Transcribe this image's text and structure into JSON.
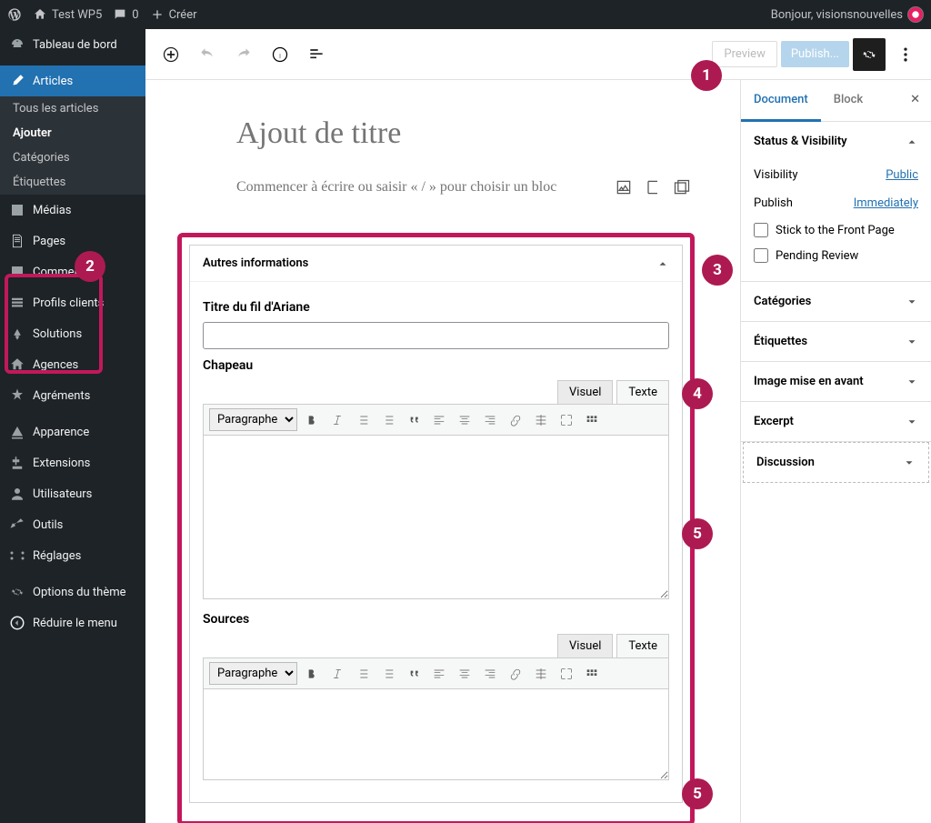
{
  "adminbar": {
    "site_name": "Test WP5",
    "comments_count": "0",
    "create": "Créer",
    "greeting": "Bonjour, visionsnouvelles"
  },
  "sidebar": {
    "dashboard": "Tableau de bord",
    "articles": "Articles",
    "submenu": {
      "all": "Tous les articles",
      "add": "Ajouter",
      "categories": "Catégories",
      "tags": "Étiquettes"
    },
    "media": "Médias",
    "pages": "Pages",
    "comments": "Commenta",
    "profils": "Profils clients",
    "solutions": "Solutions",
    "agences": "Agences",
    "agrements": "Agréments",
    "appearance": "Apparence",
    "plugins": "Extensions",
    "users": "Utilisateurs",
    "tools": "Outils",
    "settings": "Réglages",
    "theme_options": "Options du thème",
    "collapse": "Réduire le menu"
  },
  "editor": {
    "preview": "Preview",
    "publish": "Publish...",
    "title_placeholder": "Ajout de titre",
    "block_prompt": "Commencer à écrire ou saisir « / » pour choisir un bloc"
  },
  "metabox": {
    "header": "Autres informations",
    "field1_label": "Titre du fil d'Ariane",
    "field2_label": "Chapeau",
    "field3_label": "Sources",
    "tab_visual": "Visuel",
    "tab_text": "Texte",
    "format_select": "Paragraphe"
  },
  "inspector": {
    "tab_document": "Document",
    "tab_block": "Block",
    "panels": {
      "status": {
        "title": "Status & Visibility",
        "visibility_label": "Visibility",
        "visibility_value": "Public",
        "publish_label": "Publish",
        "publish_value": "Immediately",
        "stick": "Stick to the Front Page",
        "pending": "Pending Review"
      },
      "categories": "Catégories",
      "tags": "Étiquettes",
      "featured": "Image mise en avant",
      "excerpt": "Excerpt",
      "discussion": "Discussion"
    }
  },
  "badges": {
    "n1": "1",
    "n2": "2",
    "n3": "3",
    "n4": "4",
    "n5": "5"
  }
}
